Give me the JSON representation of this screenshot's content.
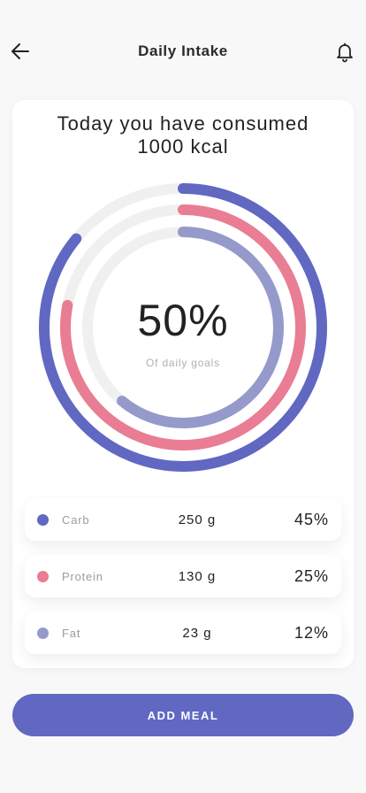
{
  "header": {
    "title": "Daily Intake",
    "back_icon": "arrow-left-icon",
    "bell_icon": "bell-icon"
  },
  "summary": {
    "headline_line1": "Today you have consumed",
    "headline_line2": "1000 kcal",
    "percent": "50%",
    "subtitle": "Of daily goals"
  },
  "rings": {
    "track_color": "#f0f0f0",
    "outer": {
      "color": "#6068c2",
      "fraction": 0.86
    },
    "middle": {
      "color": "#e97d93",
      "fraction": 0.78
    },
    "inner": {
      "color": "#959acb",
      "fraction": 0.61
    }
  },
  "macros": [
    {
      "name": "Carb",
      "grams": "250 g",
      "percent": "45%",
      "color": "#6068c2"
    },
    {
      "name": "Protein",
      "grams": "130 g",
      "percent": "25%",
      "color": "#e97d93"
    },
    {
      "name": "Fat",
      "grams": "23 g",
      "percent": "12%",
      "color": "#959acb"
    }
  ],
  "actions": {
    "add_meal_label": "ADD MEAL"
  }
}
